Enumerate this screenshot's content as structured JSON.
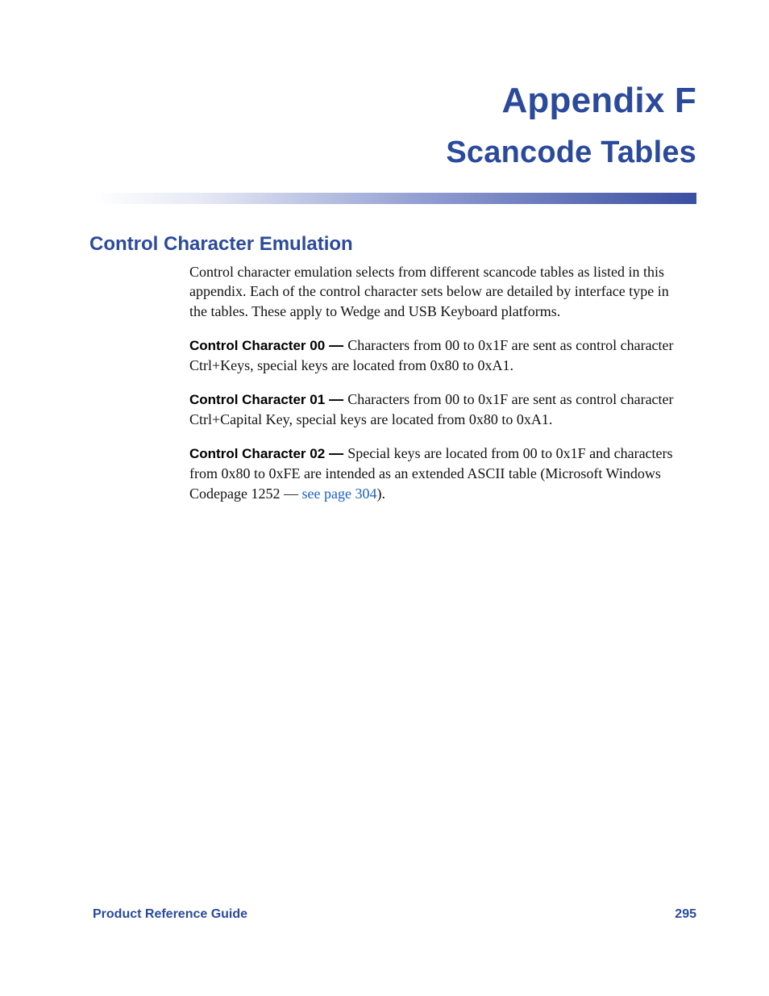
{
  "title": {
    "appendix": "Appendix F",
    "sub": "Scancode Tables"
  },
  "section": {
    "heading": "Control Character Emulation",
    "intro": "Control character emulation selects from different scancode tables as listed in this appendix. Each of the control character sets below are detailed by interface type in the tables. These apply to Wedge and USB Keyboard platforms.",
    "items": [
      {
        "label": "Control Character 00",
        "dash": "  —  ",
        "text": "Characters from 00 to 0x1F are sent as control character Ctrl+Keys, special keys are located from 0x80 to 0xA1."
      },
      {
        "label": "Control Character 01",
        "dash": "  —  ",
        "text": "Characters from 00 to 0x1F are sent as control character Ctrl+Capital Key, special keys are located from 0x80 to 0xA1."
      },
      {
        "label": "Control Character 02",
        "dash": "  —  ",
        "text_a": "Special keys are located from 00 to 0x1F and characters from 0x80 to 0xFE are intended as an extended ASCII table (Microsoft Windows Codepage 1252 — ",
        "link": "see page 304",
        "text_b": ")."
      }
    ]
  },
  "footer": {
    "left": "Product Reference Guide",
    "right": "295"
  }
}
